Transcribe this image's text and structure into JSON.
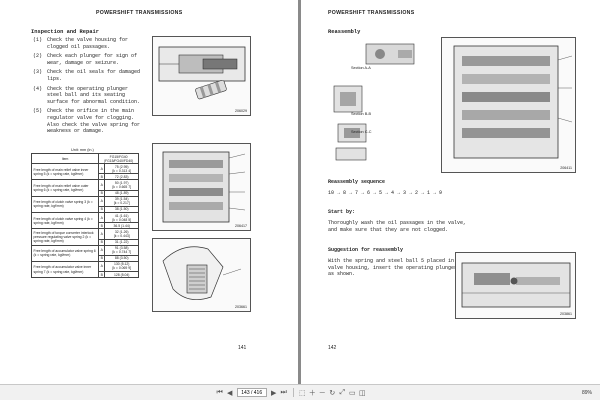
{
  "left_page": {
    "running_head": "POWERSHIFT TRANSMISSIONS",
    "section_title": "Inspection and Repair",
    "steps": [
      {
        "num": "(1)",
        "text": "Check the valve housing for clogged oil passages."
      },
      {
        "num": "(2)",
        "text": "Check each plunger for sign of wear, damage or seizure."
      },
      {
        "num": "(3)",
        "text": "Check the oil seals for damaged lips."
      },
      {
        "num": "(4)",
        "text": "Check the operating plunger steel ball and its seating surface for abnormal condition."
      },
      {
        "num": "(5)",
        "text": "Check the orifice in the main regulator valve for clogging. Also check the valve spring for weakness or damage."
      }
    ],
    "fig1_id": "206029",
    "unit_label": "Unit: mm (in.)",
    "table": {
      "col_item": "Item",
      "col_model": "FG15/FG40 (FG15/FG40/FD40)",
      "rows": [
        {
          "item": "Free length of main relief valve inner spring 5 (k = spring rate, kgf/mm)",
          "a": "A",
          "a_val": "75 (2.95)",
          "a_sub": "[k = 0.313 4]",
          "b": "B",
          "b_val": "72 (2.83)"
        },
        {
          "item": "Free length of main relief valve outer spring 6 (k = spring rate, kgf/mm)",
          "a": "A",
          "a_val": "50 (1.97)",
          "a_sub": "[k = 0.665 7]",
          "b": "B",
          "b_val": "48 (1.89)"
        },
        {
          "item": "Free length of clutch valve spring 3 (k = spring rate, kgf/mm)",
          "a": "A",
          "a_val": "39 (1.54)",
          "a_sub": "[k = 0.217]",
          "b": "B",
          "b_val": "38 (1.50)"
        },
        {
          "item": "Free length of clutch valve spring 4 (k = spring rate, kgf/mm)",
          "a": "A",
          "a_val": "41 (1.61)",
          "a_sub": "[k = 0.048 5]",
          "b": "B",
          "b_val": "36.5 (1.44)"
        },
        {
          "item": "Free length of torque converter interlock pressure regulating valve spring 2 (k = spring rate, kgf/mm)",
          "a": "A",
          "a_val": "32 (1.26)",
          "a_sub": "[k = 0.443]",
          "b": "B",
          "b_val": "31 (1.22)"
        },
        {
          "item": "Free length of accumulator valve spring 6 (k = spring rate, kgf/mm)",
          "a": "A",
          "a_val": "91 (3.58)",
          "a_sub": "[k = 0.744 7]",
          "b": "B",
          "b_val": "88 (3.50)"
        },
        {
          "item": "Free length of accumulator valve inner spring 7 (k = spring rate, kgf/mm)",
          "a": "A",
          "a_val": "130 (5.12)",
          "a_sub": "[k = 0.069 9]",
          "b": "B",
          "b_val": "128 (5.04)"
        }
      ]
    },
    "fig2_id": "206417",
    "fig3_id": "203661",
    "page_number": "141"
  },
  "right_page": {
    "running_head": "POWERSHIFT TRANSMISSIONS",
    "section_title": "Reassembly",
    "section_labels": [
      "Section A-A",
      "Section B-B",
      "Section C-C"
    ],
    "fig1_id": "206411",
    "sequence_title": "Reassembly sequence",
    "sequence": "10 → 8 → 7 → 6 → 5 → 4 → 3 → 2 → 1 → 9",
    "start_title": "Start by:",
    "start_text": "Thoroughly wash the oil passages in the valve, and make sure that they are not clogged.",
    "suggestion_title": "Suggestion for reassembly",
    "suggestion_text": "With the spring and steel ball 5 placed in the valve housing, insert the operating plunger 5 as shown.",
    "fig2_id": "203861",
    "page_number": "142"
  },
  "toolbar": {
    "page_value": "143 / 416",
    "zoom": "89%"
  }
}
